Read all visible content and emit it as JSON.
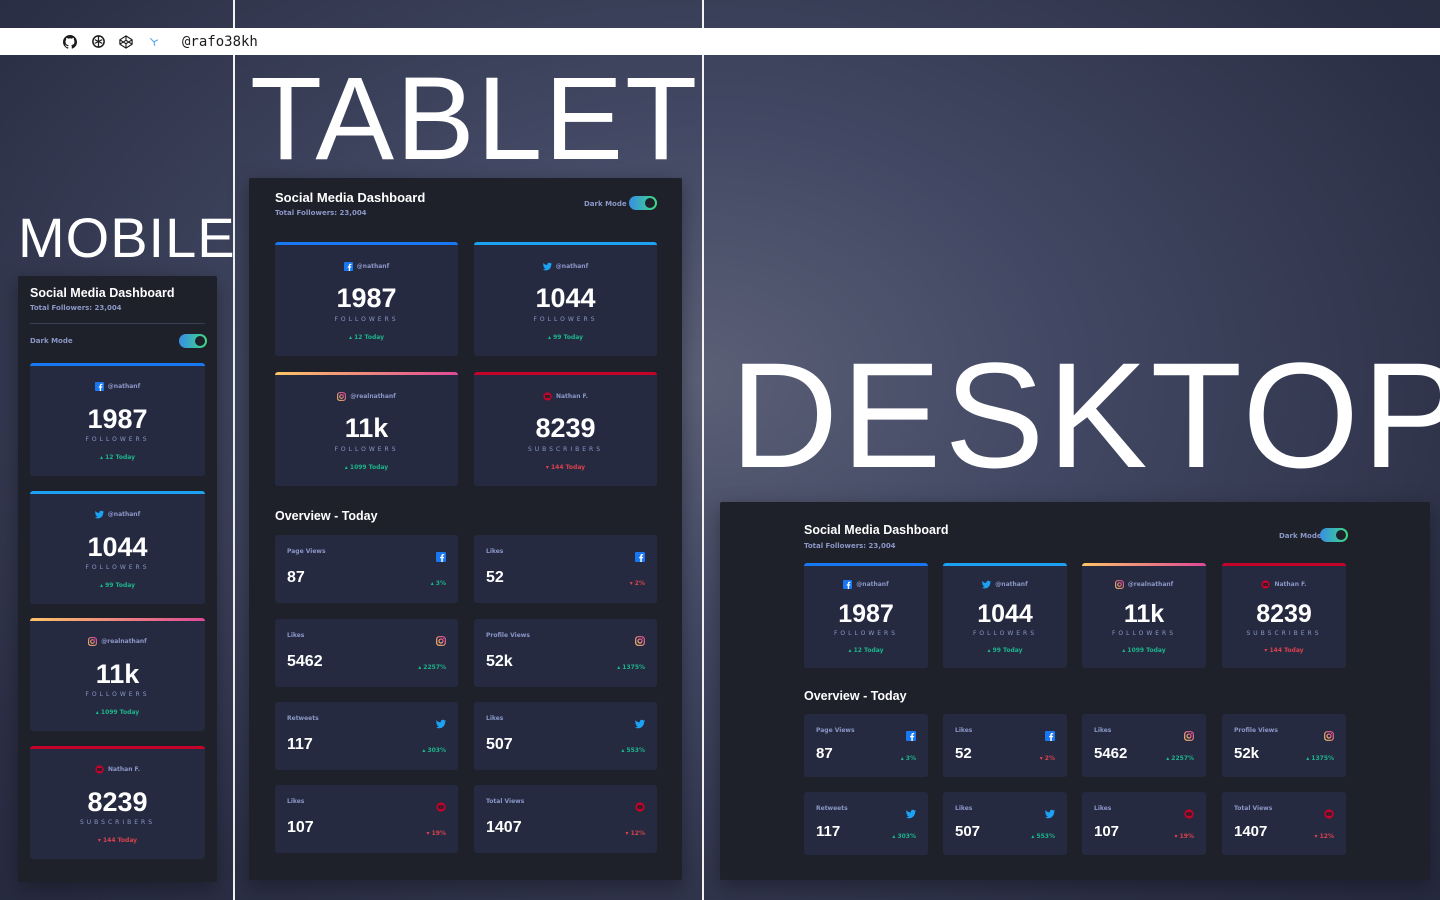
{
  "topbar": {
    "handle": "@rafo38kh",
    "icons": [
      "github-icon",
      "openai-icon",
      "codepen-icon",
      "site-icon"
    ]
  },
  "labels": {
    "mobile": "MOBILE",
    "tablet": "TABLET",
    "desktop": "DESKTOP"
  },
  "dashboard": {
    "title": "Social Media Dashboard",
    "total": "Total Followers: 23,004",
    "dark_mode": "Dark Mode",
    "overview_title": "Overview - Today"
  },
  "cards": [
    {
      "network": "facebook",
      "handle": "@nathanf",
      "count": "1987",
      "caption": "FOLLOWERS",
      "today": "▴ 12 Today",
      "trend": "up"
    },
    {
      "network": "twitter",
      "handle": "@nathanf",
      "count": "1044",
      "caption": "FOLLOWERS",
      "today": "▴ 99 Today",
      "trend": "up"
    },
    {
      "network": "instagram",
      "handle": "@realnathanf",
      "count": "11k",
      "caption": "FOLLOWERS",
      "today": "▴ 1099 Today",
      "trend": "up"
    },
    {
      "network": "youtube",
      "handle": "Nathan F.",
      "count": "8239",
      "caption": "SUBSCRIBERS",
      "today": "▾ 144 Today",
      "trend": "down"
    }
  ],
  "overview": [
    {
      "label": "Page Views",
      "network": "facebook",
      "value": "87",
      "pct": "▴ 3%",
      "trend": "up"
    },
    {
      "label": "Likes",
      "network": "facebook",
      "value": "52",
      "pct": "▾ 2%",
      "trend": "down"
    },
    {
      "label": "Likes",
      "network": "instagram",
      "value": "5462",
      "pct": "▴ 2257%",
      "trend": "up"
    },
    {
      "label": "Profile Views",
      "network": "instagram",
      "value": "52k",
      "pct": "▴ 1375%",
      "trend": "up"
    },
    {
      "label": "Retweets",
      "network": "twitter",
      "value": "117",
      "pct": "▴ 303%",
      "trend": "up"
    },
    {
      "label": "Likes",
      "network": "twitter",
      "value": "507",
      "pct": "▴ 553%",
      "trend": "up"
    },
    {
      "label": "Likes",
      "network": "youtube",
      "value": "107",
      "pct": "▾ 19%",
      "trend": "down"
    },
    {
      "label": "Total Views",
      "network": "youtube",
      "value": "1407",
      "pct": "▾ 12%",
      "trend": "down"
    }
  ],
  "colors": {
    "facebook": "#1877f2",
    "twitter": "#1da1f2",
    "instagram": "#df4996",
    "youtube": "#c4032a",
    "up": "#1db489",
    "down": "#dc414c"
  }
}
